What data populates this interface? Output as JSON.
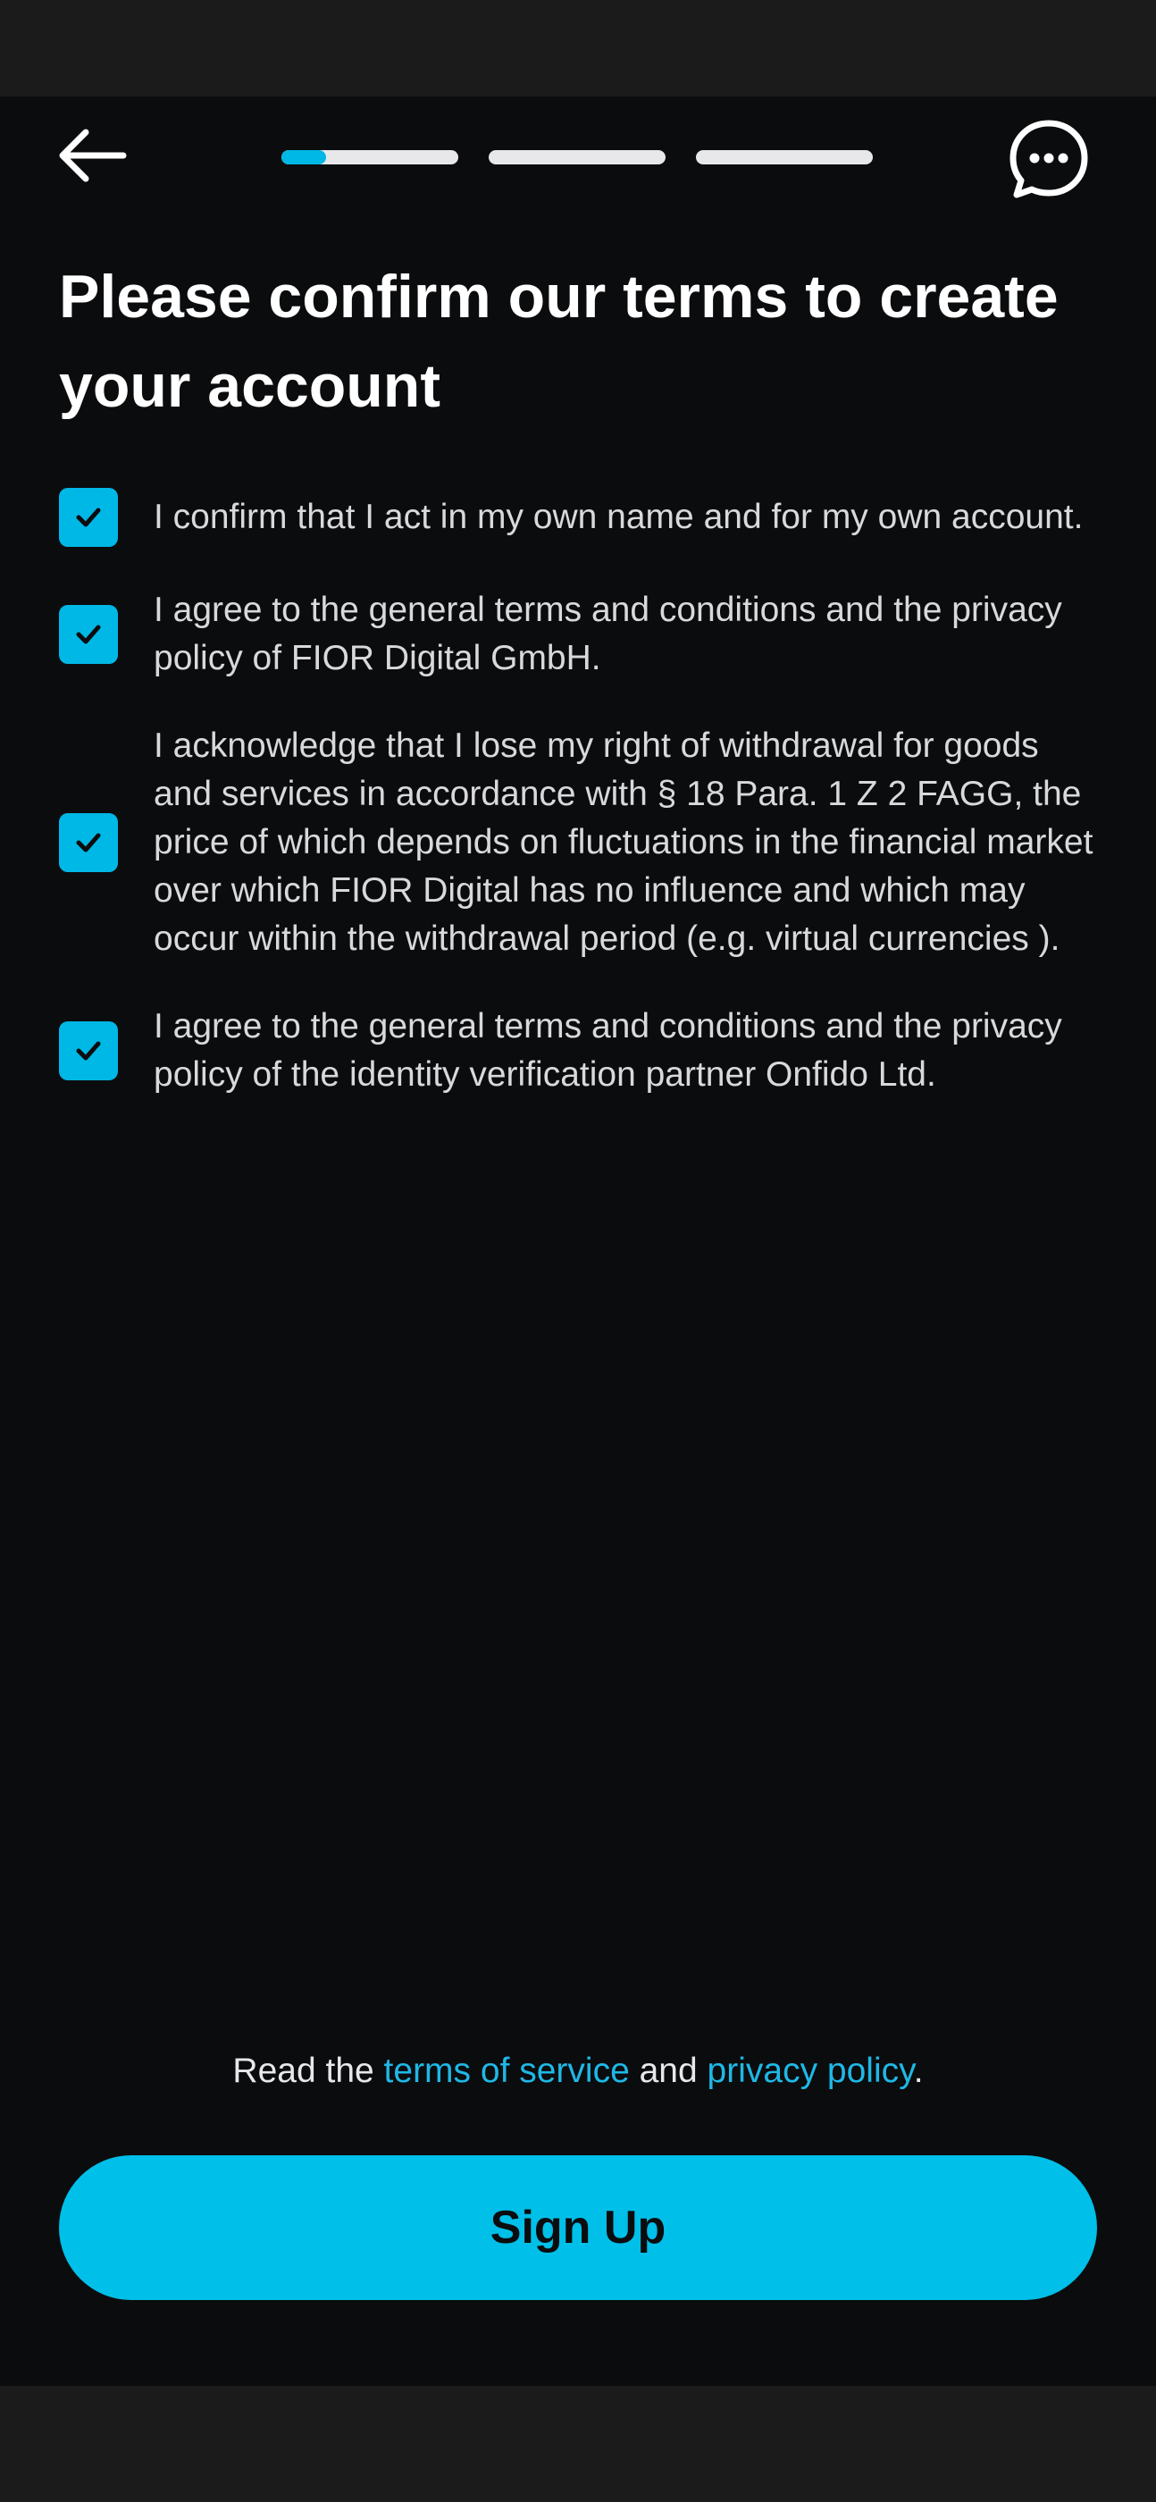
{
  "header": {
    "back_icon": "arrow-left-icon",
    "chat_icon": "chat-bubble-icon",
    "progress": {
      "total_steps": 3,
      "current_step": 1,
      "current_step_fraction": 0.25
    }
  },
  "title": "Please confirm our terms to create your account",
  "terms": [
    {
      "checked": true,
      "text": "I confirm that I act in my own name and for my own account."
    },
    {
      "checked": true,
      "text": "I agree to the general terms and conditions and the privacy policy of FIOR Digital GmbH."
    },
    {
      "checked": true,
      "text": "I acknowledge that I lose my right of withdrawal for goods and services in accordance with § 18 Para. 1 Z 2 FAGG, the price of which depends on fluctuations in the financial market over which FIOR Digital has no influence and which may occur within the withdrawal period (e.g. virtual currencies )."
    },
    {
      "checked": true,
      "text": "I agree to the general terms and conditions and the privacy policy of the identity verification partner Onfido Ltd."
    }
  ],
  "footer": {
    "read_prefix": "Read the ",
    "terms_link": "terms of service",
    "and_text": " and ",
    "privacy_link": "privacy policy",
    "suffix": "."
  },
  "signup_label": "Sign Up",
  "colors": {
    "accent": "#00b8e6",
    "background": "#0b0c0e",
    "progress_track": "#e8e8ea"
  }
}
